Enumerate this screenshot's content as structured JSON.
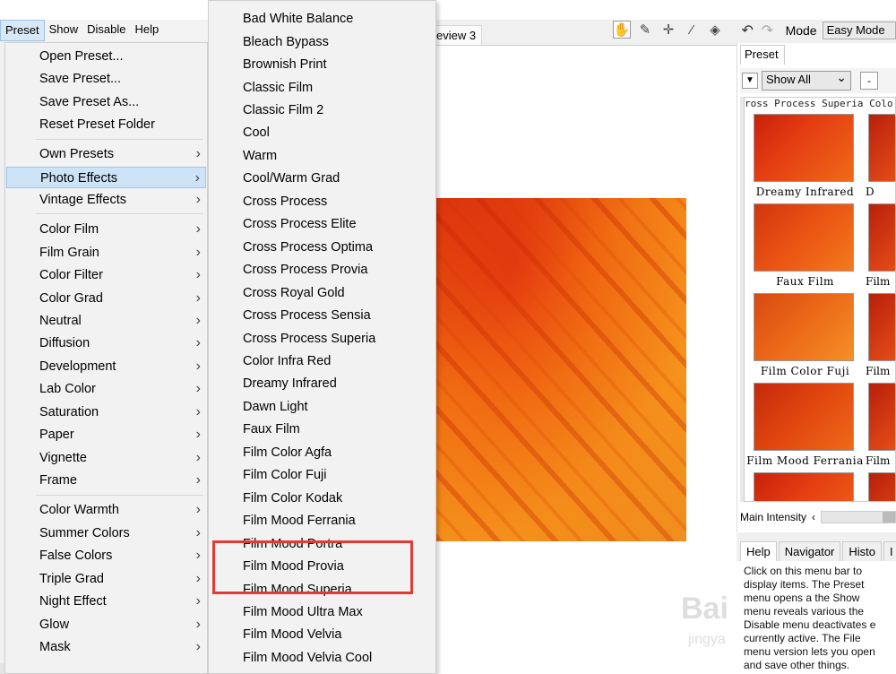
{
  "menubar": {
    "items": [
      "Preset",
      "Show",
      "Disable",
      "Help"
    ]
  },
  "preview_tab": "eview 3",
  "toolbar": {
    "mode_label": "Mode",
    "mode_value": "Easy Mode"
  },
  "preset_panel": {
    "tab": "Preset",
    "filter": "Show All",
    "minus": "-",
    "strip_top": "ross Process Superia Colo",
    "thumbs": [
      "Dreamy Infrared",
      "Faux Film",
      "Film Color Fuji",
      "Film Mood Ferrania"
    ],
    "thumbs_right": [
      "D",
      "Film",
      "Film",
      "Film"
    ],
    "intensity_label": "Main Intensity"
  },
  "bottom_tabs": [
    "Help",
    "Navigator",
    "Histo",
    "I"
  ],
  "help_text": "Click on this menu bar to display items. The Preset menu opens a the Show menu reveals various the Disable menu deactivates e currently active. The File menu version lets you open and save other things.",
  "menu1": {
    "items": [
      {
        "label": "Open Preset...",
        "sub": false
      },
      {
        "label": "Save Preset...",
        "sub": false
      },
      {
        "label": "Save Preset As...",
        "sub": false
      },
      {
        "label": "Reset Preset Folder",
        "sub": false
      },
      {
        "label": "Own Presets",
        "sub": true
      },
      {
        "label": "Photo Effects",
        "sub": true
      },
      {
        "label": "Vintage Effects",
        "sub": true
      },
      {
        "label": "Color Film",
        "sub": true
      },
      {
        "label": "Film Grain",
        "sub": true
      },
      {
        "label": "Color Filter",
        "sub": true
      },
      {
        "label": "Color Grad",
        "sub": true
      },
      {
        "label": "Neutral",
        "sub": true
      },
      {
        "label": "Diffusion",
        "sub": true
      },
      {
        "label": "Development",
        "sub": true
      },
      {
        "label": "Lab Color",
        "sub": true
      },
      {
        "label": "Saturation",
        "sub": true
      },
      {
        "label": "Paper",
        "sub": true
      },
      {
        "label": "Vignette",
        "sub": true
      },
      {
        "label": "Frame",
        "sub": true
      },
      {
        "label": "Color Warmth",
        "sub": true
      },
      {
        "label": "Summer Colors",
        "sub": true
      },
      {
        "label": "False Colors",
        "sub": true
      },
      {
        "label": "Triple Grad",
        "sub": true
      },
      {
        "label": "Night Effect",
        "sub": true
      },
      {
        "label": "Glow",
        "sub": true
      },
      {
        "label": "Mask",
        "sub": true
      }
    ],
    "highlighted": "Photo Effects"
  },
  "menu2": {
    "items": [
      "Bad White Balance",
      "Bleach Bypass",
      "Brownish Print",
      "Classic Film",
      "Classic Film 2",
      "Cool",
      "Warm",
      "Cool/Warm Grad",
      "Cross Process",
      "Cross Process Elite",
      "Cross Process Optima",
      "Cross Process Provia",
      "Cross Royal Gold",
      "Cross Process Sensia",
      "Cross Process Superia",
      "Color Infra Red",
      "Dreamy Infrared",
      "Dawn Light",
      "Faux Film",
      "Film Color Agfa",
      "Film Color Fuji",
      "Film Color Kodak",
      "Film Mood Ferrania",
      "Film Mood Portra",
      "Film Mood Provia",
      "Film Mood Superia",
      "Film Mood Ultra Max",
      "Film Mood Velvia",
      "Film Mood Velvia Cool"
    ]
  },
  "watermark": "Bai",
  "watermark_sub": "jingya"
}
